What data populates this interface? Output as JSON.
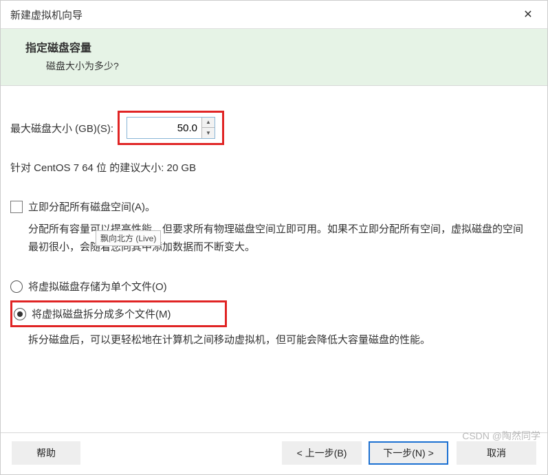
{
  "title": "新建虚拟机向导",
  "close_glyph": "✕",
  "banner": {
    "title": "指定磁盘容量",
    "subtitle": "磁盘大小为多少?"
  },
  "disk": {
    "label": "最大磁盘大小 (GB)(S):",
    "value": "50.0",
    "recommend": "针对 CentOS 7 64 位 的建议大小: 20 GB"
  },
  "allocate": {
    "checkbox_label": "立即分配所有磁盘空间(A)。",
    "desc": "分配所有容量可以提高性能，但要求所有物理磁盘空间立即可用。如果不立即分配所有空间，虚拟磁盘的空间最初很小，会随着您向其中添加数据而不断变大。"
  },
  "tooltip_text": "飘向北方 (Live)",
  "radios": {
    "single": "将虚拟磁盘存储为单个文件(O)",
    "split": "将虚拟磁盘拆分成多个文件(M)",
    "split_desc": "拆分磁盘后，可以更轻松地在计算机之间移动虚拟机，但可能会降低大容量磁盘的性能。"
  },
  "buttons": {
    "help": "帮助",
    "back": "< 上一步(B)",
    "next": "下一步(N) >",
    "cancel": "取消"
  },
  "spinner_up": "▲",
  "spinner_down": "▼",
  "watermark": "CSDN @陶然同学"
}
